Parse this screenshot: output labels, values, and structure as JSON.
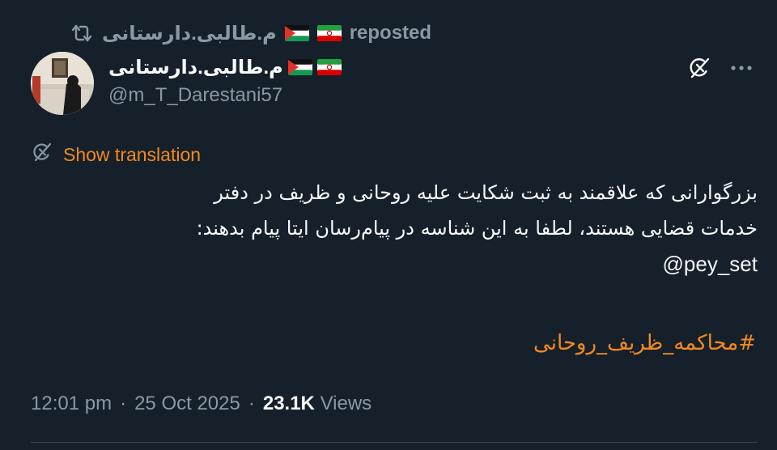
{
  "repost": {
    "name": "م.طالبی.دارستانی",
    "label": "reposted",
    "icon": "repost-icon"
  },
  "author": {
    "name": "م.طالبی.دارستانی",
    "handle": "@m_T_Darestani57",
    "flags": [
      "iran-flag-icon",
      "palestine-flag-icon"
    ]
  },
  "actions": {
    "grok": "grok-icon",
    "more": "more-icon"
  },
  "translate": {
    "label": "Show translation",
    "icon": "translate-globe-icon"
  },
  "body": {
    "line1": "بزرگوارانی که علاقمند به ثبت شکایت علیه روحانی و ظریف در دفتر",
    "line2": "خدمات قضایی هستند، لطفا به این شناسه در پیام‌رسان ایتا پیام بدهند:",
    "line3": "@pey_set",
    "hashtag": "#محاکمه_ظریف_روحانی"
  },
  "meta": {
    "time": "12:01 pm",
    "separator": "·",
    "date": "25 Oct 2025",
    "views_count": "23.1K",
    "views_label": "Views"
  },
  "colors": {
    "background": "#15202b",
    "text": "#f7f9f9",
    "muted": "#8b98a5",
    "accent": "#f4891f",
    "divider": "#38444d"
  }
}
